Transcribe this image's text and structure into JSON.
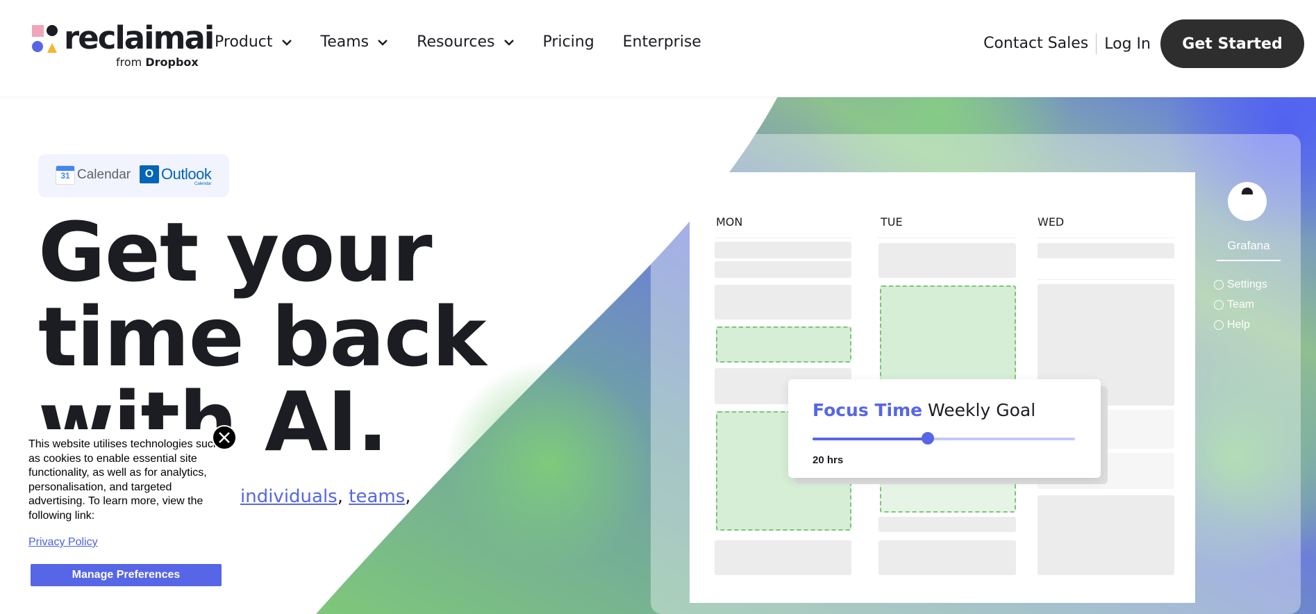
{
  "header": {
    "logo": {
      "name": "reclaimai",
      "tagline_prefix": "from",
      "tagline_brand": "Dropbox"
    },
    "nav": [
      {
        "label": "Product",
        "dropdown": true
      },
      {
        "label": "Teams",
        "dropdown": true
      },
      {
        "label": "Resources",
        "dropdown": true
      },
      {
        "label": "Pricing",
        "dropdown": false
      },
      {
        "label": "Enterprise",
        "dropdown": false
      }
    ],
    "contact_label": "Contact Sales",
    "login_label": "Log In",
    "cta_label": "Get Started"
  },
  "hero": {
    "integrations": {
      "calendar_day": "31",
      "calendar_label": "Calendar",
      "outlook_letter": "O",
      "outlook_label": "Outlook",
      "outlook_sub": "Calendar"
    },
    "headline": [
      "Get your",
      "time back",
      "with AI."
    ],
    "subline": {
      "link1": "individuals",
      "sep1": ",",
      "link2": "teams",
      "sep2": ","
    }
  },
  "mockup": {
    "days": [
      "MON",
      "TUE",
      "WED"
    ],
    "side_panel": {
      "user": "Grafana",
      "links": [
        "Settings",
        "Team",
        "Help"
      ]
    },
    "goal": {
      "title_accent": "Focus Time",
      "title_rest": "Weekly Goal",
      "value_label": "20 hrs",
      "slider_fraction": 0.44
    }
  },
  "cookie": {
    "text": "This website utilises technologies such as cookies to enable essential site functionality, as well as for analytics, personalisation, and targeted advertising. To learn more, view the following link:",
    "link": "Privacy Policy",
    "button": "Manage Preferences"
  },
  "colors": {
    "accent": "#5666e6",
    "dark": "#1c1d22",
    "cta_bg": "#2e2e2e",
    "focus_green": "#d6eed6"
  }
}
